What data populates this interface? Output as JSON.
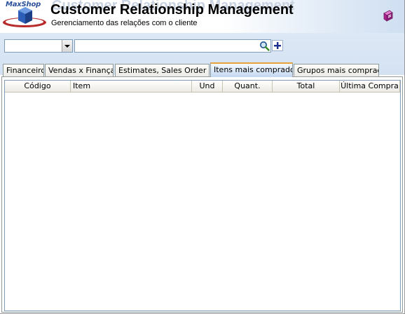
{
  "app": {
    "logo_text": "MaxShop",
    "title": "Customer Relationship Management",
    "subtitle": "Gerenciamento das relações com o cliente",
    "help_icon": "book-icon"
  },
  "search": {
    "combo_value": "",
    "input_value": "",
    "input_placeholder": "",
    "search_icon": "magnifier-icon",
    "add_icon": "plus-icon"
  },
  "tabs": [
    {
      "label": "Financeiro",
      "active": false
    },
    {
      "label": "Vendas x Finanças",
      "active": false
    },
    {
      "label": "Estimates, Sales Order ...",
      "active": false
    },
    {
      "label": "Itens mais comprados",
      "active": true
    },
    {
      "label": "Grupos mais comprados",
      "active": false
    }
  ],
  "grid": {
    "columns": [
      {
        "label": "Código"
      },
      {
        "label": "Item"
      },
      {
        "label": "Und"
      },
      {
        "label": "Quant."
      },
      {
        "label": "Total"
      },
      {
        "label": "Última Compra"
      }
    ],
    "rows": []
  },
  "colors": {
    "accent_tab": "#e6a23c",
    "band_bg": "#d4e2f3",
    "border": "#7f9db9"
  }
}
